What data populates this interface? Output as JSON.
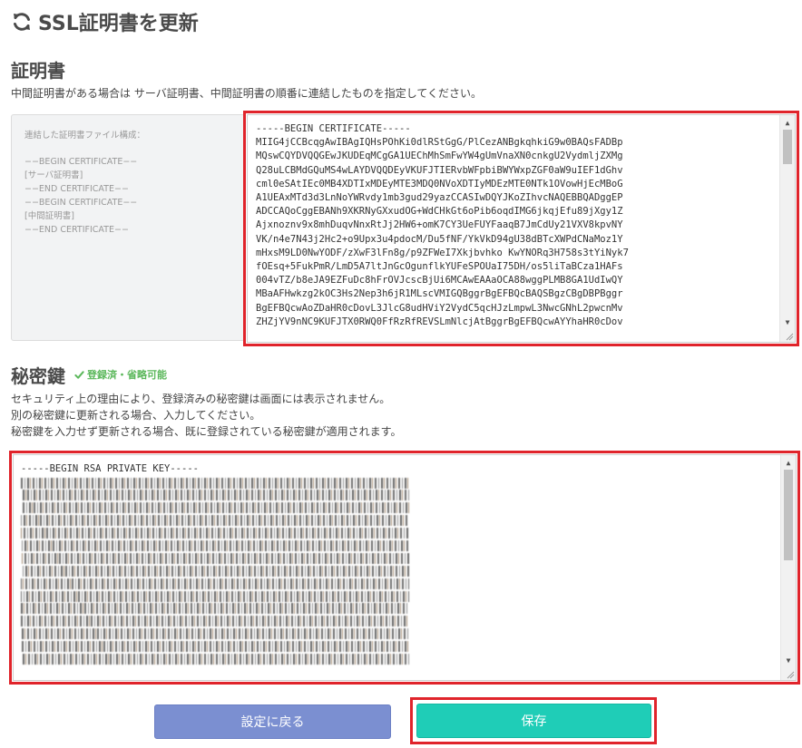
{
  "page": {
    "title": "SSL証明書を更新"
  },
  "certificate": {
    "title": "証明書",
    "description": "中間証明書がある場合は サーバ証明書、中間証明書の順番に連結したものを指定してください。",
    "example": {
      "title": "連結した証明書ファイル構成：",
      "lines": [
        "−−BEGIN CERTIFICATE−−",
        "[サーバ証明書]",
        "−−END CERTIFICATE−−",
        "−−BEGIN CERTIFICATE−−",
        "[中間証明書]",
        "−−END CERTIFICATE−−"
      ]
    },
    "value_lines": [
      "-----BEGIN CERTIFICATE-----",
      "MIIG4jCCBcqgAwIBAgIQHsPOhKi0dlRStGgG/PlCezANBgkqhkiG9w0BAQsFADBp",
      "MQswCQYDVQQGEwJKUDEqMCgGA1UEChMhSmFwYW4gUmVnaXN0cnkgU2VydmljZXMg",
      "Q28uLCBMdGQuMS4wLAYDVQQDEyVKUFJTIERvbWFpbiBWYWxpZGF0aW9uIEF1dGhv",
      "cml0eSAtIEc0MB4XDTIxMDEyMTE3MDQ0NVoXDTIyMDEzMTE0NTk1OVowHjEcMBoG",
      "A1UEAxMTd3d3LnNoYWRvdy1mb3gud29yazCCASIwDQYJKoZIhvcNAQEBBQADggEP",
      "ADCCAQoCggEBANh9XKRNyGXxudOG+WdCHkGt6oPib6oqdIMG6jkqjEfu89jXgy1Z",
      "Ajxnoznv9x8mhDuqvNnxRtJj2HW6+omK7CY3UeFUYFaaqB7JmCdUy21VXV8kpvNY",
      "VK/n4e7N43j2Hc2+o9Upx3u4pdocM/Du5fNF/YkVkD94gU38dBTcXWPdCNaMoz1Y",
      "mHxsM9LD0NwYODF/zXwF3lFn8g/p9ZFWeI7Xkjbvhko KwYNORq3H758s3tYiNyk7",
      "fOEsq+5FukPmR/LmD5A7ltJnGcOgunflkYUFeSPOUaI75DH/os5liTaBCza1HAFs",
      "004vTZ/b8eJA9EZFuDc8hFrOVJcscBjUi6MCAwEAAaOCA88wggPLMB8GA1UdIwQY",
      "MBaAFHwkzg2kOC3Hs2Nep3h6jR1MLscVMIGQBggrBgEFBQcBAQSBgzCBgDBPBggr",
      "BgEFBQcwAoZDaHR0cDovL3JlcG8udHViY2VydC5qcHJzLmpwL3NwcGNhL2pwcnMv",
      "ZHZjYV9nNC9KUFJTX0RWQ0FfRzRfREVSLmNlcjAtBggrBgEFBQcwAYYhaHR0cDov"
    ]
  },
  "private_key": {
    "title": "秘密鍵",
    "badge": "登録済・省略可能",
    "description_lines": [
      "セキュリティ上の理由により、登録済みの秘密鍵は画面には表示されません。",
      "別の秘密鍵に更新される場合、入力してください。",
      "秘密鍵を入力せず更新される場合、既に登録されている秘密鍵が適用されます。"
    ],
    "header_line": "-----BEGIN RSA PRIVATE KEY-----",
    "redacted_line_count": 15
  },
  "buttons": {
    "back_label": "設定に戻る",
    "save_label": "保存"
  },
  "colors": {
    "highlight": "#e0242b",
    "back_button": "#7b8fd1",
    "save_button": "#1fcdb7",
    "badge": "#5cb85c"
  }
}
